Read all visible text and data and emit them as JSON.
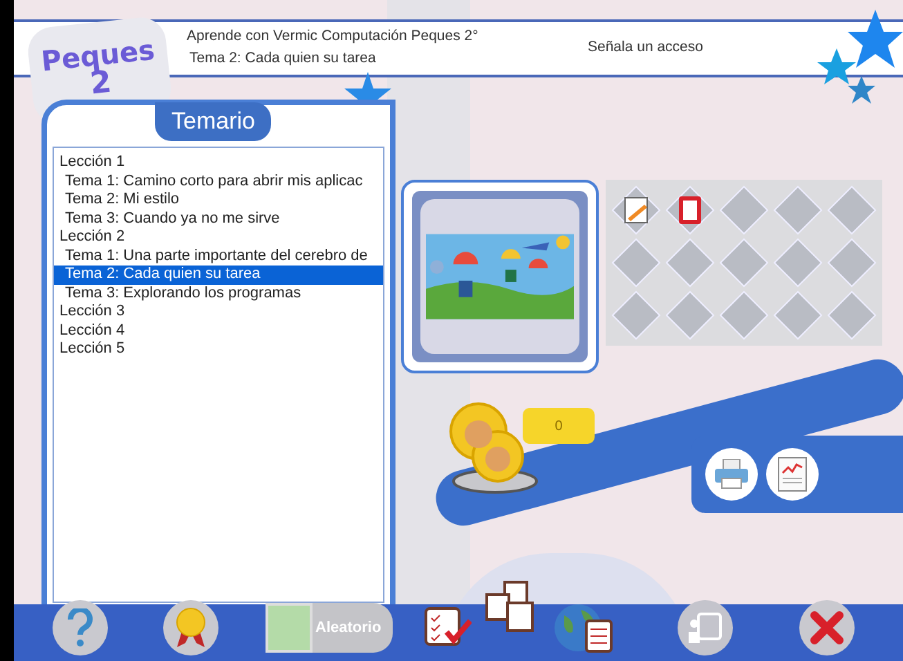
{
  "header": {
    "title": "Aprende con Vermic Computación Peques 2°",
    "subtitle": "Tema 2: Cada quien su tarea",
    "instruction": "Señala un acceso"
  },
  "logo": {
    "name": "Peques",
    "grade": "2"
  },
  "temario": {
    "title": "Temario",
    "items": [
      {
        "label": "Lección 1",
        "selected": false,
        "children": [
          {
            "label": "Tema 1: Camino corto para abrir mis aplicac",
            "selected": false
          },
          {
            "label": "Tema 2: Mi estilo",
            "selected": false
          },
          {
            "label": "Tema 3: Cuando ya no me sirve",
            "selected": false
          }
        ]
      },
      {
        "label": "Lección 2",
        "selected": false,
        "children": [
          {
            "label": "Tema 1: Una parte importante del cerebro de",
            "selected": false
          },
          {
            "label": "Tema 2: Cada quien su tarea",
            "selected": true
          },
          {
            "label": "Tema 3: Explorando los programas",
            "selected": false
          }
        ]
      },
      {
        "label": "Lección 3",
        "selected": false
      },
      {
        "label": "Lección 4",
        "selected": false
      },
      {
        "label": "Lección 5",
        "selected": false
      }
    ]
  },
  "score": {
    "value": "0"
  },
  "toolbar": {
    "random_button": "Aleatorio"
  }
}
